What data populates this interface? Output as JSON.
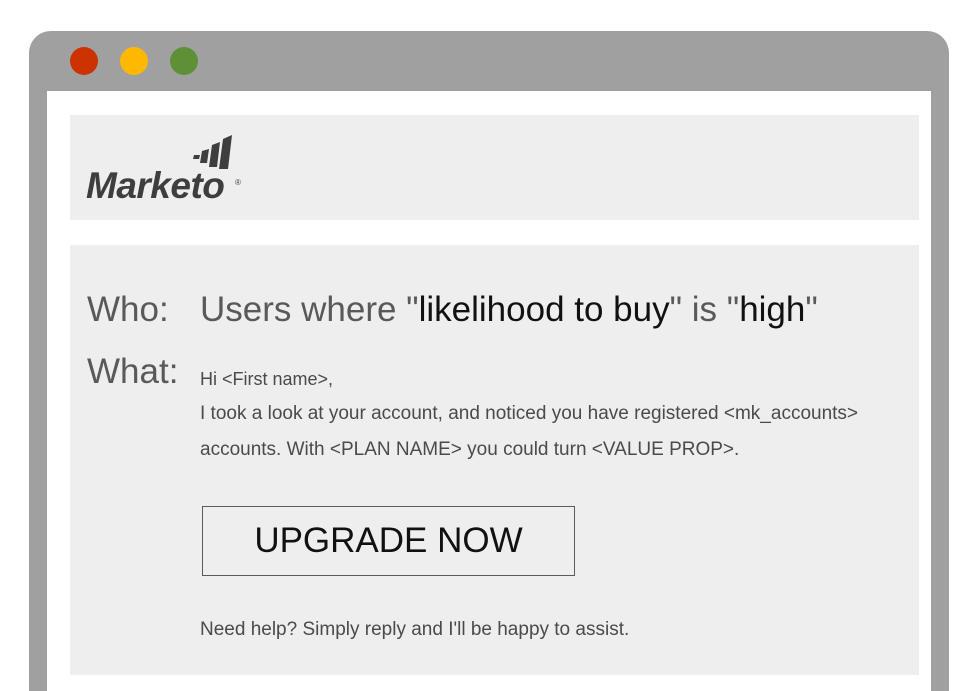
{
  "window": {
    "frame_color": "#a0a0a0",
    "buttons": [
      {
        "name": "close",
        "color": "#cc3300"
      },
      {
        "name": "minimize",
        "color": "#ffb800"
      },
      {
        "name": "zoom",
        "color": "#5f8f36"
      }
    ]
  },
  "header": {
    "logo_text": "Marketo",
    "logo_mark": "®"
  },
  "who": {
    "label": "Who:",
    "prefix": "Users where \"",
    "attribute": "likelihood to buy",
    "middle": "\" is \"",
    "value": "high",
    "suffix": "\""
  },
  "what": {
    "label": "What:",
    "greeting": "Hi <First name>,",
    "body_line_1": "I took a look at your account, and noticed you have registered <mk_accounts>",
    "body_line_2": "accounts. With <PLAN NAME> you could turn <VALUE PROP>."
  },
  "cta": {
    "label": "UPGRADE NOW"
  },
  "footer": {
    "help_text": "Need help? Simply reply and I'll be happy to assist."
  }
}
